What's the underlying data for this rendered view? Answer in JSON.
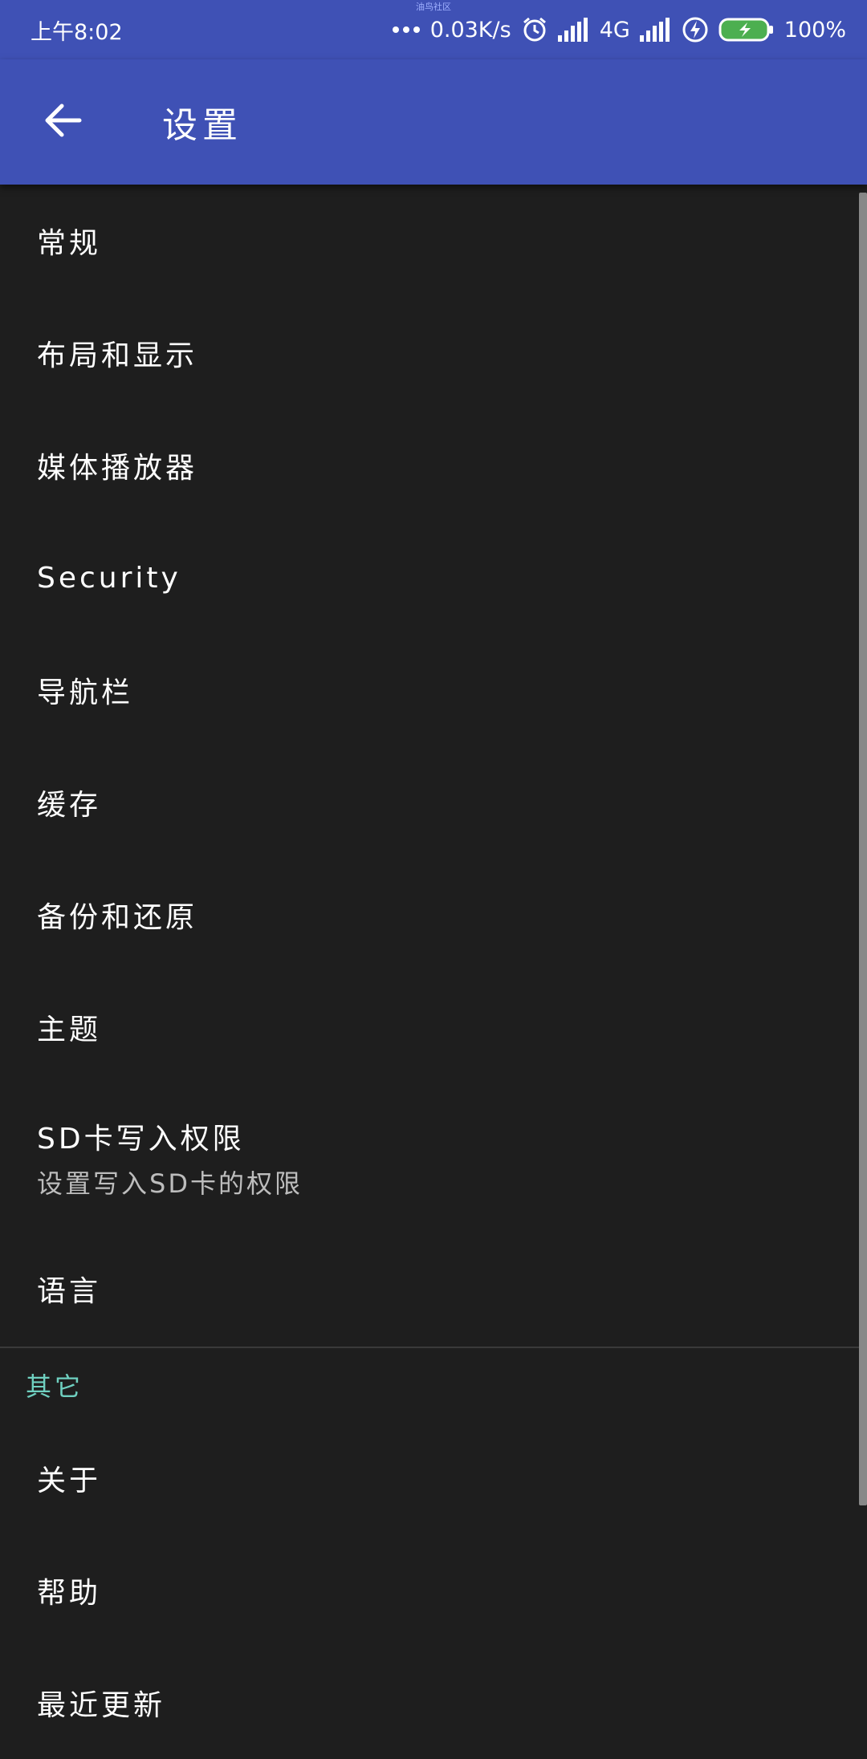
{
  "status_bar": {
    "time": "上午8:02",
    "carrier_tag": "油鸟社区",
    "net_speed": "0.03K/s",
    "network_type": "4G",
    "battery": "100%"
  },
  "app_bar": {
    "title": "设置"
  },
  "settings": {
    "items": [
      {
        "label": "常规"
      },
      {
        "label": "布局和显示"
      },
      {
        "label": "媒体播放器"
      },
      {
        "label": "Security"
      },
      {
        "label": "导航栏"
      },
      {
        "label": "缓存"
      },
      {
        "label": "备份和还原"
      },
      {
        "label": "主题"
      },
      {
        "label": "SD卡写入权限",
        "summary": "设置写入SD卡的权限"
      },
      {
        "label": "语言"
      }
    ],
    "other_section": {
      "header": "其它",
      "items": [
        {
          "label": "关于"
        },
        {
          "label": "帮助"
        },
        {
          "label": "最近更新"
        }
      ]
    }
  },
  "colors": {
    "primary": "#3f51b5",
    "background": "#1e1e1e",
    "accent": "#6fd0c0",
    "battery_green": "#4caf50"
  },
  "icons": [
    "more-dots-icon",
    "alarm-icon",
    "signal-icon",
    "charging-icon",
    "battery-icon",
    "arrow-back-icon"
  ]
}
